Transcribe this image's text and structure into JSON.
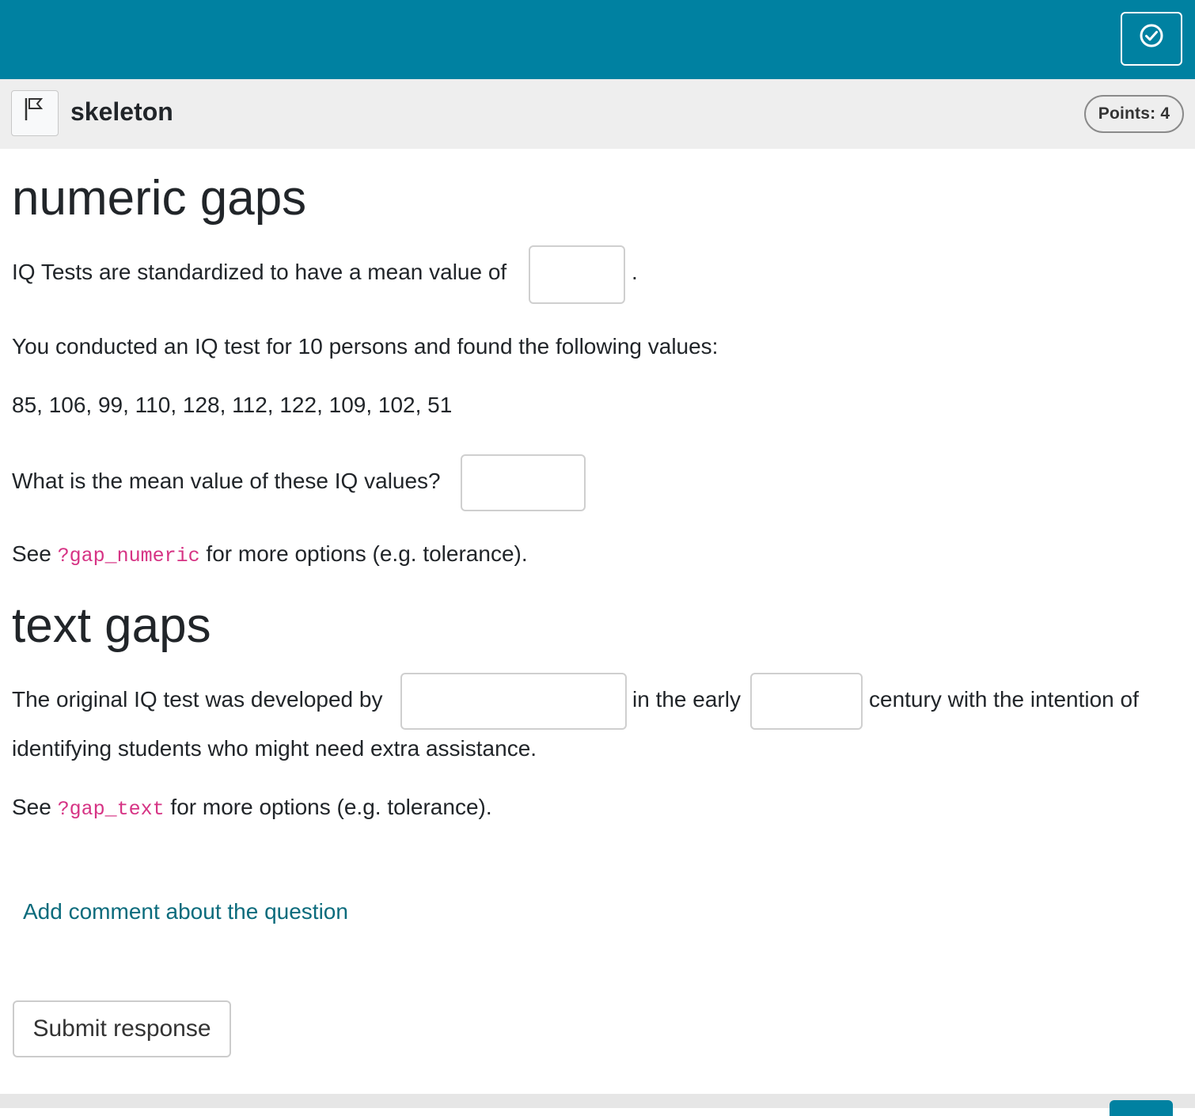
{
  "question": {
    "title": "skeleton",
    "points": "Points: 4"
  },
  "numeric_section": {
    "heading": "numeric gaps",
    "line1_text": "IQ Tests are standardized to have a mean value of",
    "line1_end": ".",
    "gap1_value": "",
    "line2_text": "You conducted an IQ test for 10 persons and found the following values:",
    "values_text": "85, 106, 99, 110, 128, 112, 122, 109, 102, 51",
    "line4_text": "What is the mean value of these IQ values?",
    "gap2_value": "",
    "help_prefix": "See",
    "help_code": "?gap_numeric",
    "help_suffix": "for more options (e.g. tolerance)."
  },
  "text_section": {
    "heading": "text gaps",
    "sentence_part1": "The original IQ test was developed by",
    "gap3_value": "",
    "sentence_part2": "in the early",
    "gap4_value": "",
    "sentence_part3": "century with the intention of",
    "sentence_line2": "identifying students who might need extra assistance.",
    "help_prefix": "See",
    "help_code": "?gap_text",
    "help_suffix": "for more options (e.g. tolerance)."
  },
  "comment_link": "Add comment about the question",
  "submit_button": "Submit response",
  "icons": {
    "finish": "check-circle-icon",
    "flag": "flag-icon"
  },
  "colors": {
    "accent": "#0081a1",
    "code": "#d63384",
    "link": "#0a6b7c"
  }
}
